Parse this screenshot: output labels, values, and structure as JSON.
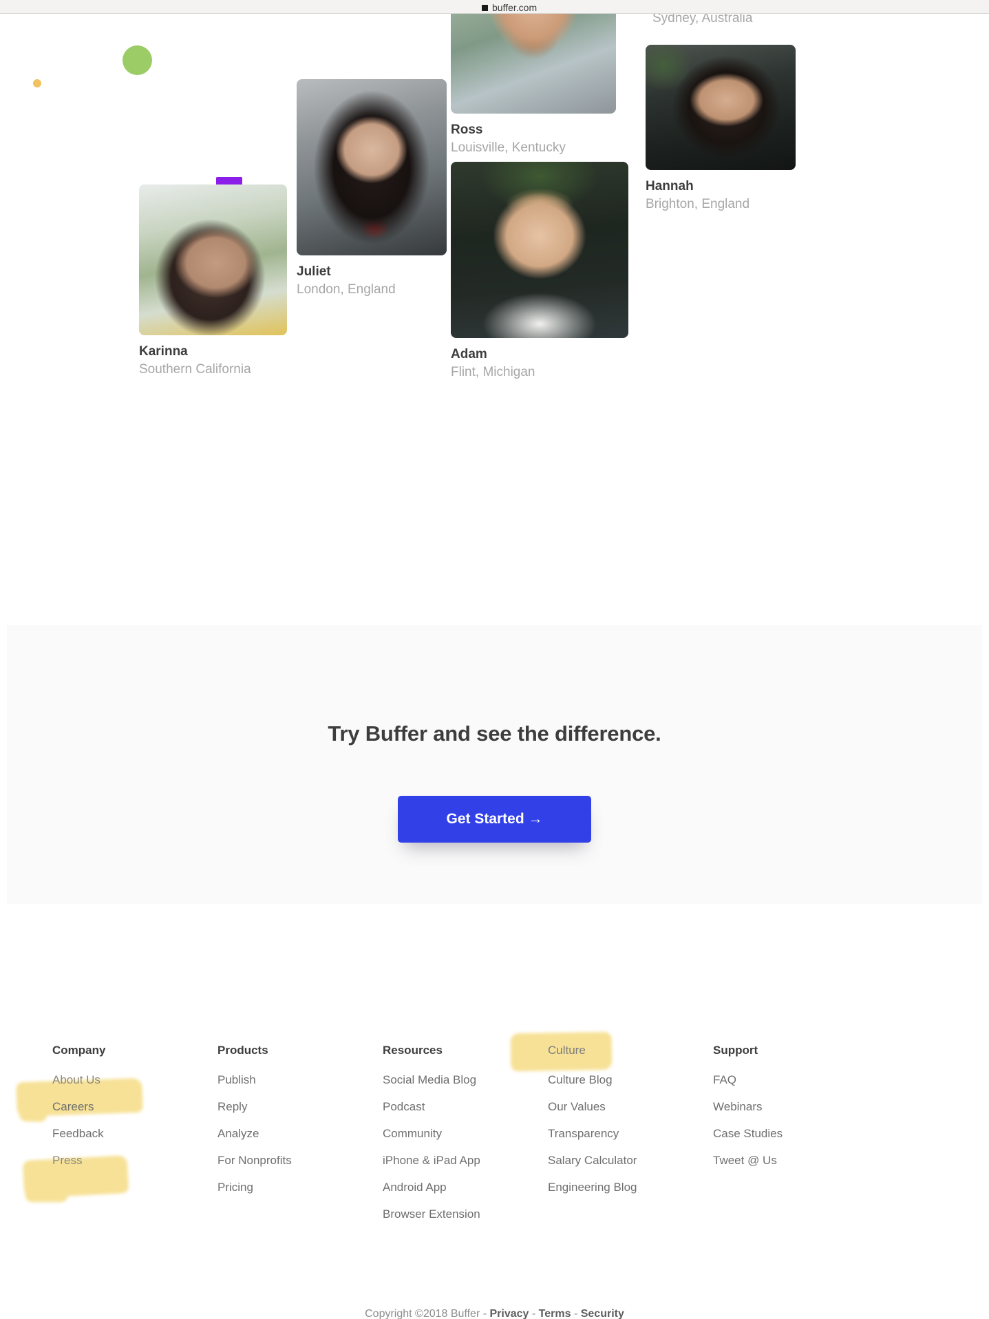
{
  "browser": {
    "tab_title": "buffer.com",
    "favicon": "square-favicon"
  },
  "colors": {
    "accent_blue": "#3240e8",
    "highlight_yellow": "#f6df8e",
    "deco_green": "#9ccc65",
    "deco_orange": "#f2c260",
    "purple_tab": "#8b1ee8",
    "cta_band_bg": "#fafafa",
    "heading_text": "#3d3d3d",
    "muted_text": "#a6a6a6"
  },
  "team": {
    "section_name": "team-collage",
    "cut_off_location_top": "Sydney, Australia",
    "members": [
      {
        "name": "Karinna",
        "location": "Southern California"
      },
      {
        "name": "Juliet",
        "location": "London, England"
      },
      {
        "name": "Ross",
        "location": "Louisville, Kentucky"
      },
      {
        "name": "Adam",
        "location": "Flint, Michigan"
      },
      {
        "name": "Hannah",
        "location": "Brighton, England"
      }
    ]
  },
  "cta": {
    "heading": "Try Buffer and see the difference.",
    "button_label": "Get Started →"
  },
  "footer": {
    "columns": [
      {
        "title": "Company",
        "title_highlighted": false,
        "links": [
          {
            "label": "About Us",
            "highlighted": true
          },
          {
            "label": "Careers",
            "highlighted": false
          },
          {
            "label": "Feedback",
            "highlighted": false
          },
          {
            "label": "Press",
            "highlighted": true
          }
        ]
      },
      {
        "title": "Products",
        "title_highlighted": false,
        "links": [
          {
            "label": "Publish",
            "highlighted": false
          },
          {
            "label": "Reply",
            "highlighted": false
          },
          {
            "label": "Analyze",
            "highlighted": false
          },
          {
            "label": "For Nonprofits",
            "highlighted": false
          },
          {
            "label": "Pricing",
            "highlighted": false
          }
        ]
      },
      {
        "title": "Resources",
        "title_highlighted": false,
        "links": [
          {
            "label": "Social Media Blog",
            "highlighted": false
          },
          {
            "label": "Podcast",
            "highlighted": false
          },
          {
            "label": "Community",
            "highlighted": false
          },
          {
            "label": "iPhone & iPad App",
            "highlighted": false
          },
          {
            "label": "Android App",
            "highlighted": false
          },
          {
            "label": "Browser Extension",
            "highlighted": false
          }
        ]
      },
      {
        "title": "Culture",
        "title_highlighted": true,
        "links": [
          {
            "label": "Culture Blog",
            "highlighted": false
          },
          {
            "label": "Our Values",
            "highlighted": false
          },
          {
            "label": "Transparency",
            "highlighted": false
          },
          {
            "label": "Salary Calculator",
            "highlighted": false
          },
          {
            "label": "Engineering Blog",
            "highlighted": false
          }
        ]
      },
      {
        "title": "Support",
        "title_highlighted": false,
        "links": [
          {
            "label": "FAQ",
            "highlighted": false
          },
          {
            "label": "Webinars",
            "highlighted": false
          },
          {
            "label": "Case Studies",
            "highlighted": false
          },
          {
            "label": "Tweet @ Us",
            "highlighted": false
          }
        ]
      }
    ],
    "copyright_prefix": "Copyright ©2018 Buffer - ",
    "copyright_links": [
      "Privacy",
      "Terms",
      "Security"
    ],
    "copyright_separator": " - "
  }
}
